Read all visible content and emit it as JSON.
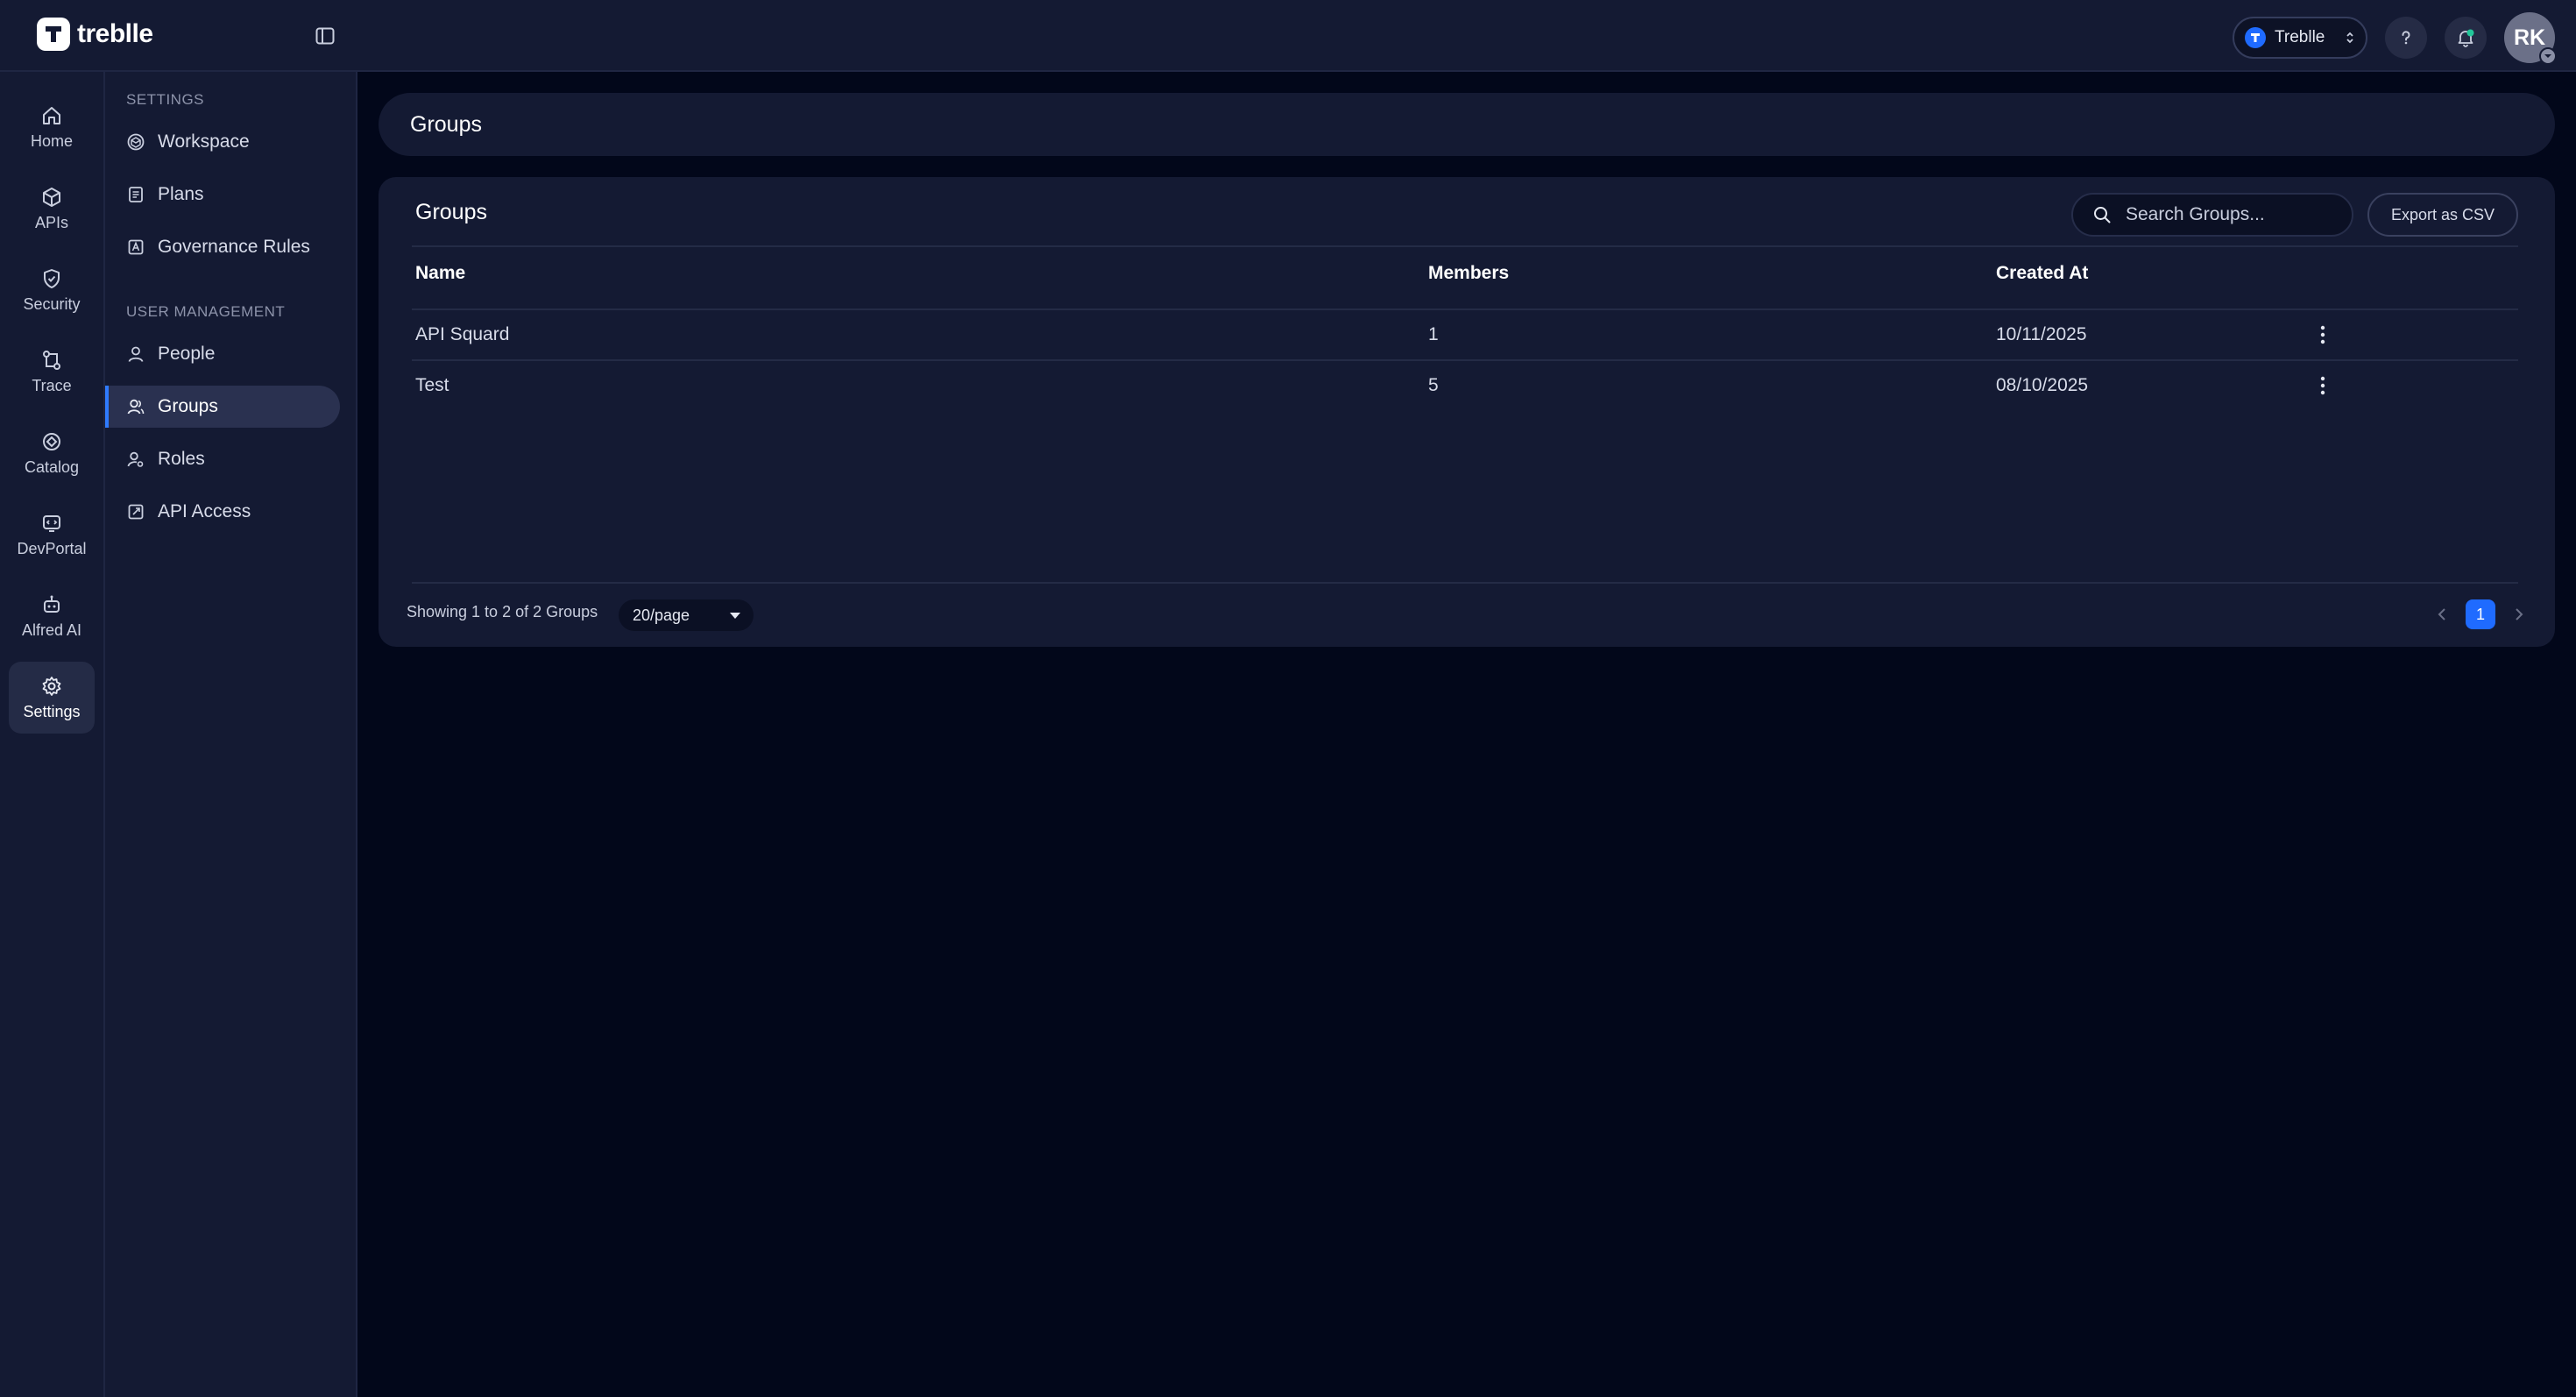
{
  "brand": {
    "name": "treblle"
  },
  "topbar": {
    "workspace": "Treblle",
    "avatar_initials": "RK"
  },
  "rail": [
    {
      "label": "Home",
      "icon": "home-icon"
    },
    {
      "label": "APIs",
      "icon": "cube-icon"
    },
    {
      "label": "Security",
      "icon": "shield-icon"
    },
    {
      "label": "Trace",
      "icon": "trace-icon"
    },
    {
      "label": "Catalog",
      "icon": "catalog-icon"
    },
    {
      "label": "DevPortal",
      "icon": "devportal-icon"
    },
    {
      "label": "Alfred AI",
      "icon": "robot-icon"
    },
    {
      "label": "Settings",
      "icon": "gear-icon",
      "active": true
    }
  ],
  "subnav": {
    "settings_title": "SETTINGS",
    "user_mgmt_title": "USER MANAGEMENT",
    "items": [
      {
        "label": "Workspace",
        "icon": "workspace-icon"
      },
      {
        "label": "Plans",
        "icon": "plans-icon"
      },
      {
        "label": "Governance Rules",
        "icon": "governance-icon"
      },
      {
        "label": "People",
        "icon": "person-icon"
      },
      {
        "label": "Groups",
        "icon": "group-icon",
        "active": true
      },
      {
        "label": "Roles",
        "icon": "roles-icon"
      },
      {
        "label": "API Access",
        "icon": "api-access-icon"
      }
    ]
  },
  "page": {
    "title": "Groups"
  },
  "card": {
    "title": "Groups",
    "search_placeholder": "Search Groups...",
    "export_label": "Export as CSV",
    "columns": [
      "Name",
      "Members",
      "Created At"
    ],
    "rows": [
      {
        "name": "API Squard",
        "members": "1",
        "created_at": "10/11/2025"
      },
      {
        "name": "Test",
        "members": "5",
        "created_at": "08/10/2025"
      }
    ],
    "footer_text": "Showing 1 to 2 of 2 Groups",
    "page_size": "20/page",
    "current_page": "1"
  },
  "colors": {
    "accent": "#1f6bff",
    "panel": "#141a33",
    "background": "#02071a"
  }
}
